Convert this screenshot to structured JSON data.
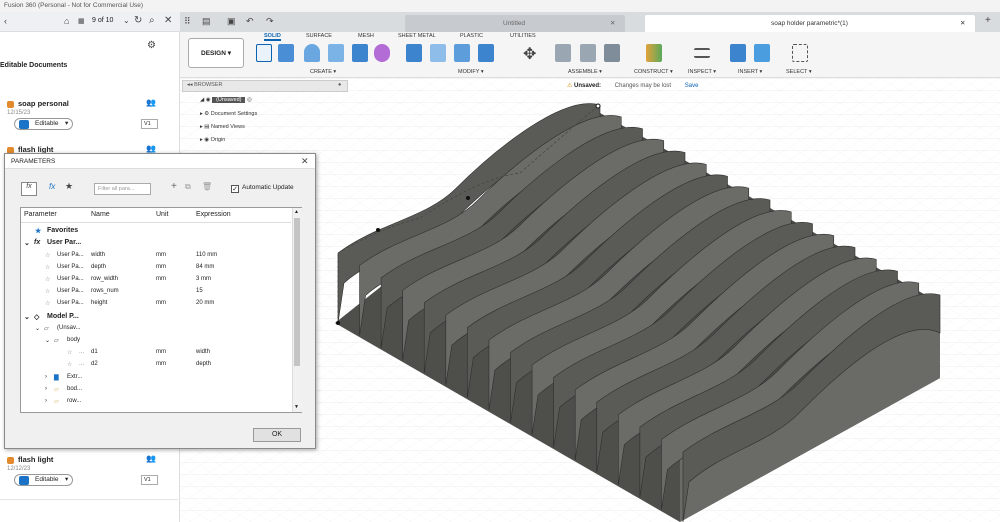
{
  "app_title": "Fusion 360 (Personal - Not for Commercial Use)",
  "left_panel": {
    "nav_count": "9 of 10",
    "heading": "Editable Documents",
    "docs": [
      {
        "name": "soap personal",
        "date": "12/15/23",
        "status": "Editable",
        "version": "V1"
      },
      {
        "name": "flash light",
        "date": "",
        "status": "",
        "version": ""
      }
    ],
    "bottom_doc": {
      "name": "flash light",
      "date": "12/12/23",
      "status": "Editable",
      "version": "V1"
    }
  },
  "tabs": [
    {
      "label": "Untitled",
      "active": false
    },
    {
      "label": "soap holder parametric*(1)",
      "active": true
    }
  ],
  "ribbon": {
    "workspace": "DESIGN",
    "tabs": [
      "SOLID",
      "SURFACE",
      "MESH",
      "SHEET METAL",
      "PLASTIC",
      "UTILITIES"
    ],
    "active_tab": "SOLID",
    "groups": [
      "CREATE",
      "MODIFY",
      "ASSEMBLE",
      "CONSTRUCT",
      "INSPECT",
      "INSERT",
      "SELECT"
    ]
  },
  "browser": {
    "title": "BROWSER",
    "root": "(Unsaved)",
    "items": [
      "Document Settings",
      "Named Views",
      "Origin"
    ]
  },
  "status": {
    "label": "Unsaved:",
    "message": "Changes may be lost",
    "save": "Save"
  },
  "dialog": {
    "title": "PARAMETERS",
    "filter_placeholder": "Filter all para...",
    "auto_update": "Automatic Update",
    "columns": [
      "Parameter",
      "Name",
      "Unit",
      "Expression"
    ],
    "favorites": "Favorites",
    "user_params_label": "User Par...",
    "user_params": [
      {
        "param": "User Pa...",
        "name": "width",
        "unit": "mm",
        "expr": "110 mm"
      },
      {
        "param": "User Pa...",
        "name": "depth",
        "unit": "mm",
        "expr": "84 mm"
      },
      {
        "param": "User Pa...",
        "name": "row_width",
        "unit": "mm",
        "expr": "3 mm"
      },
      {
        "param": "User Pa...",
        "name": "rows_num",
        "unit": "",
        "expr": "15"
      },
      {
        "param": "User Pa...",
        "name": "height",
        "unit": "mm",
        "expr": "20 mm"
      }
    ],
    "model_params_label": "Model P...",
    "model_root": "(Unsav...",
    "body": "body",
    "model_params": [
      {
        "name": "d1",
        "unit": "mm",
        "expr": "width"
      },
      {
        "name": "d2",
        "unit": "mm",
        "expr": "depth"
      }
    ],
    "sub_items": [
      "Extr...",
      "bod...",
      "row..."
    ],
    "ok": "OK"
  },
  "colors": {
    "accent": "#0b64b4",
    "doc_icon": "#e38a2e",
    "model": "#5b5b58"
  }
}
